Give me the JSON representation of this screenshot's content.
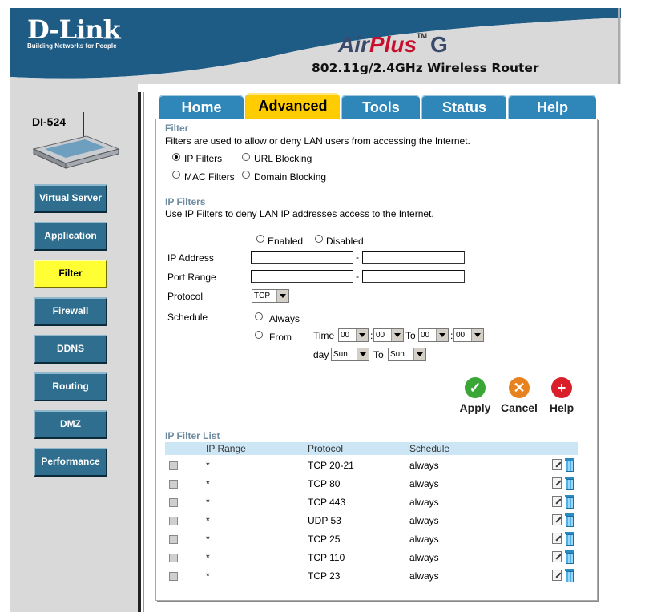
{
  "header": {
    "logo": "D-Link",
    "logo_tagline": "Building Networks for People",
    "brand_air": "Air",
    "brand_plus": "Plus",
    "brand_tm": "TM",
    "brand_g": "G",
    "subtitle": "802.11g/2.4GHz Wireless Router"
  },
  "device": {
    "model": "DI-524"
  },
  "sidebar": {
    "items": [
      {
        "label": "Virtual Server"
      },
      {
        "label": "Application"
      },
      {
        "label": "Filter"
      },
      {
        "label": "Firewall"
      },
      {
        "label": "DDNS"
      },
      {
        "label": "Routing"
      },
      {
        "label": "DMZ"
      },
      {
        "label": "Performance"
      }
    ],
    "active": "Filter"
  },
  "tabs": [
    {
      "label": "Home"
    },
    {
      "label": "Advanced"
    },
    {
      "label": "Tools"
    },
    {
      "label": "Status"
    },
    {
      "label": "Help"
    }
  ],
  "active_tab": "Advanced",
  "filter": {
    "title": "Filter",
    "description": "Filters are used to allow or deny LAN users from accessing the Internet.",
    "options": [
      {
        "label": "IP Filters",
        "selected": true
      },
      {
        "label": "URL Blocking",
        "selected": false
      },
      {
        "label": "MAC Filters",
        "selected": false
      },
      {
        "label": "Domain Blocking",
        "selected": false
      }
    ]
  },
  "ip_filters": {
    "title": "IP Filters",
    "description": "Use IP Filters to deny LAN IP addresses access to the Internet.",
    "enabled_label": "Enabled",
    "disabled_label": "Disabled",
    "ip_address_label": "IP Address",
    "port_range_label": "Port Range",
    "protocol_label": "Protocol",
    "protocol_value": "TCP",
    "schedule_label": "Schedule",
    "always_label": "Always",
    "from_label": "From",
    "time_label": "Time",
    "to_label": "To",
    "day_label": "day",
    "time_from_hour": "00",
    "time_from_min": "00",
    "time_to_hour": "00",
    "time_to_min": "00",
    "day_from": "Sun",
    "day_to": "Sun",
    "dash": "-",
    "colon": ":"
  },
  "actions": {
    "apply": "Apply",
    "cancel": "Cancel",
    "help": "Help",
    "apply_color": "#3aa635",
    "cancel_color": "#e8821e",
    "help_color": "#d9202a"
  },
  "ip_filter_list": {
    "title": "IP Filter List",
    "columns": [
      "IP Range",
      "Protocol",
      "Schedule"
    ],
    "rows": [
      {
        "ip_range": "*",
        "protocol": "TCP 20-21",
        "schedule": "always"
      },
      {
        "ip_range": "*",
        "protocol": "TCP 80",
        "schedule": "always"
      },
      {
        "ip_range": "*",
        "protocol": "TCP 443",
        "schedule": "always"
      },
      {
        "ip_range": "*",
        "protocol": "UDP 53",
        "schedule": "always"
      },
      {
        "ip_range": "*",
        "protocol": "TCP 25",
        "schedule": "always"
      },
      {
        "ip_range": "*",
        "protocol": "TCP 110",
        "schedule": "always"
      },
      {
        "ip_range": "*",
        "protocol": "TCP 23",
        "schedule": "always"
      }
    ]
  },
  "colors": {
    "header_blue": "#1e5c86",
    "tab_blue": "#2f86b8",
    "tab_active": "#ffcc00",
    "side_button": "#2f6e8e",
    "side_active": "#ffff33",
    "section_title": "#6e8ca0",
    "list_header": "#cde6f5"
  }
}
